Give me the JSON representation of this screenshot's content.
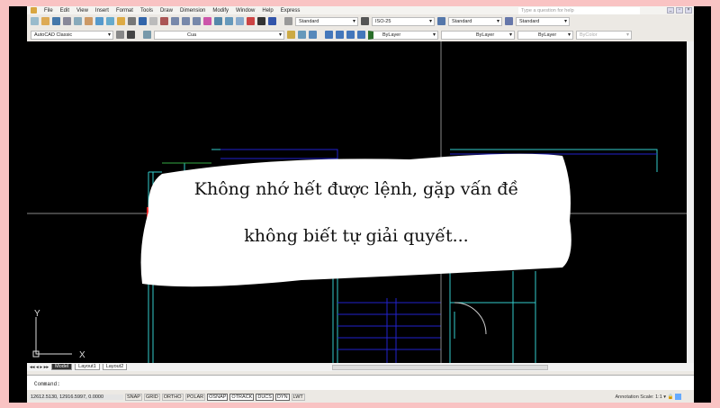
{
  "menu": [
    "File",
    "Edit",
    "View",
    "Insert",
    "Format",
    "Tools",
    "Draw",
    "Dimension",
    "Modify",
    "Window",
    "Help",
    "Express"
  ],
  "help_placeholder": "Type a question for help",
  "toolbar": {
    "text_style": "Standard",
    "dim_style": "ISO-25",
    "table_style": "Standard",
    "mleader_style": "Standard",
    "workspace": "AutoCAD Classic",
    "layer": "Cua",
    "color": "ByLayer",
    "linetype": "ByLayer",
    "lineweight": "ByLayer",
    "plotstyle": "ByColor"
  },
  "tabs": [
    "Model",
    "Layout1",
    "Layout2"
  ],
  "command_label": "Command:",
  "coords": "12612.5130, 12916.5997, 0.0000",
  "status_buttons": [
    "SNAP",
    "GRID",
    "ORTHO",
    "POLAR",
    "OSNAP",
    "OTRACK",
    "DUCS",
    "DYN",
    "LWT"
  ],
  "annotation_scale_label": "Annotation Scale:",
  "annotation_scale": "1:1",
  "ucs": {
    "x": "X",
    "y": "Y"
  },
  "overlay": {
    "line1": "Không nhớ hết được lệnh, gặp vấn đề",
    "line2": "không biết tự giải quyết..."
  }
}
